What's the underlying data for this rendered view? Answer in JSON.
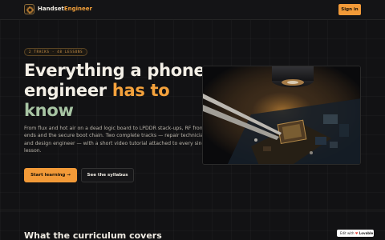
{
  "header": {
    "brand_part1": "Handset",
    "brand_part2": "Engineer",
    "signin_label": "Sign in"
  },
  "hero": {
    "badge": "2 TRACKS · 48 LESSONS",
    "headline_part1": "Everything a phone engineer ",
    "headline_part2": "has to",
    "headline_part3": "know",
    "lede": "From flux and hot air on a dead logic board to LPDDR stack-ups, RF front ends and the secure boot chain. Two complete tracks — repair technician and design engineer — with a short video tutorial attached to every single lesson.",
    "primary_cta": "Start learning",
    "primary_cta_arrow": "→",
    "secondary_cta": "See the syllabus"
  },
  "section": {
    "title": "What the curriculum covers"
  },
  "edit_badge": {
    "prefix": "Edit with",
    "brand": "Lovable"
  },
  "colors": {
    "accent": "#f29a38",
    "headline_sage": "#a7c4a3",
    "background": "#121214"
  },
  "icons": {
    "logo": "chip-icon",
    "arrow": "arrow-right-icon",
    "edit_badge": "heart-icon"
  }
}
